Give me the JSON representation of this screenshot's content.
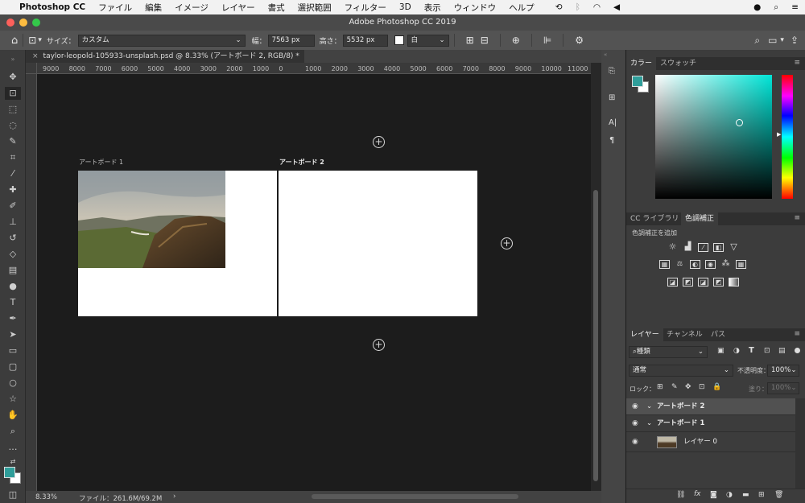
{
  "menubar": {
    "apple": "",
    "app": "Photoshop CC",
    "items": [
      "ファイル",
      "編集",
      "イメージ",
      "レイヤー",
      "書式",
      "選択範囲",
      "フィルター",
      "3D",
      "表示",
      "ウィンドウ",
      "ヘルプ"
    ]
  },
  "window": {
    "title": "Adobe Photoshop CC 2019"
  },
  "options": {
    "size_label": "サイズ：",
    "size_value": "カスタム",
    "width_label": "幅：",
    "width_value": "7563 px",
    "height_label": "高さ：",
    "height_value": "5532 px",
    "color_value": "白"
  },
  "document": {
    "tab_title": "taylor-leopold-105933-unsplash.psd @ 8.33% (アートボード 2, RGB/8) *",
    "zoom": "8.33%",
    "file_info": "ファイル：261.6M/69.2M"
  },
  "ruler": {
    "ticks": [
      "9000",
      "8000",
      "7000",
      "6000",
      "5000",
      "4000",
      "3000",
      "2000",
      "1000",
      "0",
      "1000",
      "2000",
      "3000",
      "4000",
      "5000",
      "6000",
      "7000",
      "8000",
      "9000",
      "10000",
      "11000"
    ]
  },
  "artboards": [
    {
      "label": "アートボード 1"
    },
    {
      "label": "アートボード 2"
    }
  ],
  "color_panel": {
    "tabs": [
      "カラー",
      "スウォッチ"
    ],
    "fg": "#2f9e9a",
    "bg": "#ffffff",
    "field_hue": "#00e6d8"
  },
  "adjustments_panel": {
    "tabs": [
      "CC ライブラリ",
      "色調補正"
    ],
    "hint": "色調補正を追加"
  },
  "layers_panel": {
    "tabs": [
      "レイヤー",
      "チャンネル",
      "パス"
    ],
    "filter": "種類",
    "blend": "通常",
    "opacity_label": "不透明度：",
    "opacity": "100%",
    "lock_label": "ロック：",
    "fill_label": "塗り：",
    "fill": "100%",
    "layers": [
      {
        "name": "アートボード 2",
        "selected": true
      },
      {
        "name": "アートボード 1",
        "selected": false
      },
      {
        "name": "レイヤー 0",
        "selected": false
      }
    ]
  }
}
